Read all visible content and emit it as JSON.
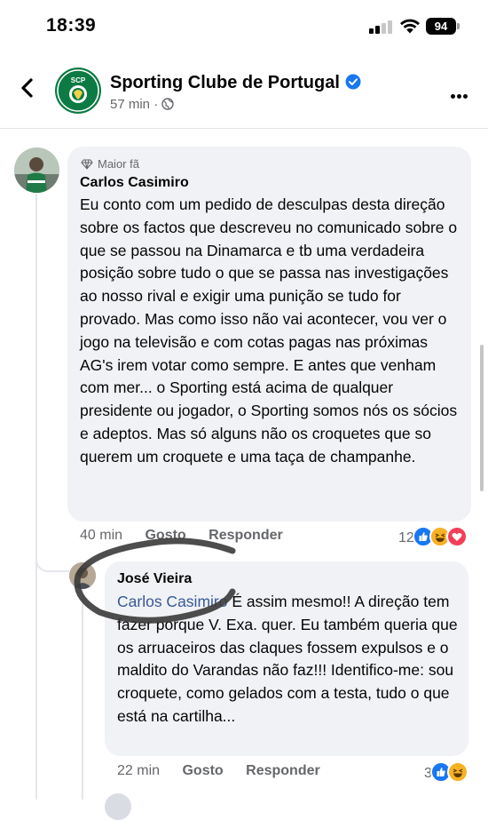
{
  "status_bar": {
    "time": "18:39",
    "battery": "94"
  },
  "post_header": {
    "page_name": "Sporting Clube de Portugal",
    "time_ago": "57 min",
    "separator": "·"
  },
  "comments": [
    {
      "badge": "Maior fã",
      "author": "Carlos Casimiro",
      "text": "Eu conto com um pedido de desculpas desta direção sobre os factos que descreveu no comunicado sobre o que se passou na Dinamarca e tb uma verdadeira posição sobre tudo o que se passa nas investigações ao nosso rival e exigir uma punição se tudo for provado. Mas como isso não vai acontecer, vou ver o jogo na televisão e com cotas pagas nas próximas AG's irem votar como sempre. E antes que venham com mer... o Sporting está acima de qualquer presidente ou jogador, o Sporting somos nós os sócios e adeptos. Mas só alguns não os croquetes que so querem um croquete e uma taça de champanhe.",
      "time": "40 min",
      "like_label": "Gosto",
      "reply_label": "Responder",
      "reaction_count": "12",
      "reactions": [
        "like",
        "haha",
        "love"
      ]
    }
  ],
  "reply": {
    "author": "José Vieira",
    "mention": "Carlos Casimiro",
    "text": " É assim mesmo!! A direção tem fazer porque V. Exa. quer. Eu também queria que os arruaceiros das claques fossem expulsos e o maldito do Varandas não faz!!! Identifico-me: sou croquete, como gelados com a testa, tudo o que está na cartilha...",
    "time": "22 min",
    "like_label": "Gosto",
    "reply_label": "Responder",
    "reaction_count": "3",
    "reactions": [
      "like",
      "haha"
    ]
  },
  "colors": {
    "accent": "#1877f2",
    "bubble": "#f0f2f5",
    "secondary_text": "#65676b",
    "mention": "#385898",
    "brand_green": "#0c7a43",
    "scribble": "#3a3a3a"
  },
  "icons": [
    "back-chevron-icon",
    "verified-badge-icon",
    "globe-icon",
    "more-icon",
    "diamond-icon",
    "like-reaction-icon",
    "haha-reaction-icon",
    "love-reaction-icon"
  ]
}
